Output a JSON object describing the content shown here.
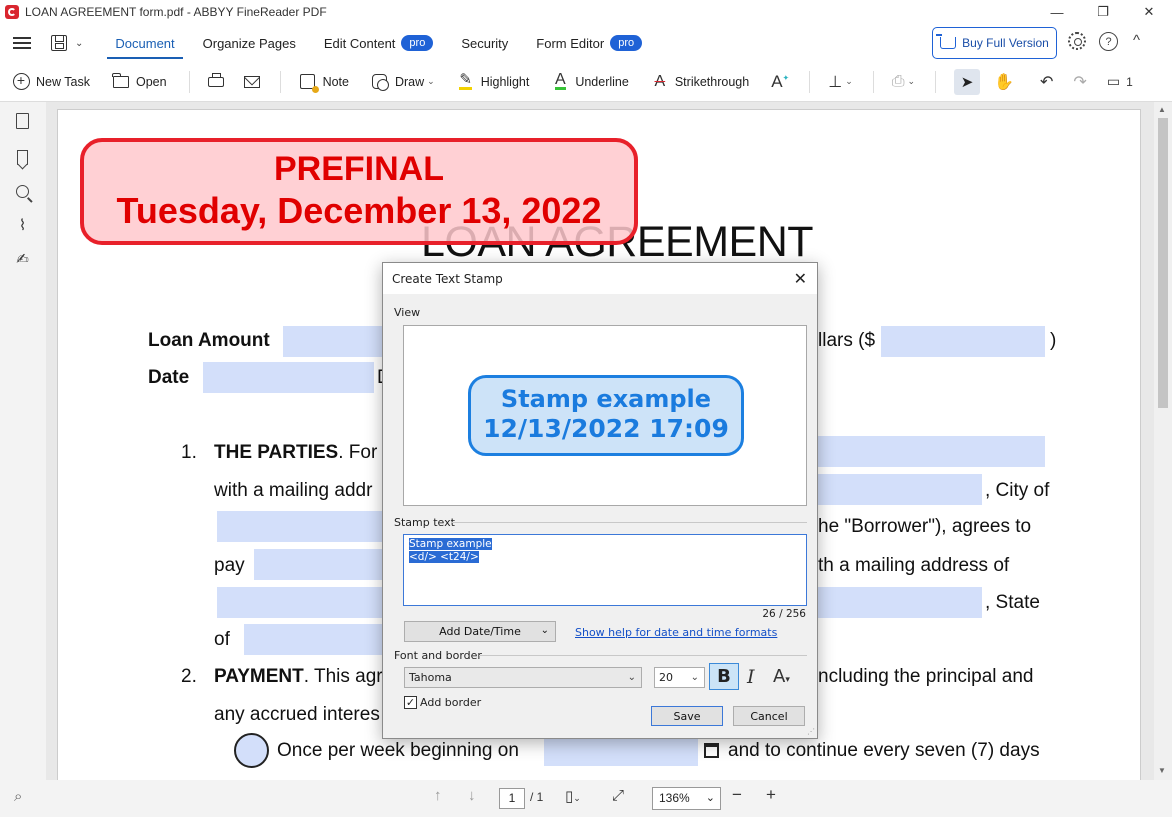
{
  "window": {
    "title": "LOAN AGREEMENT form.pdf - ABBYY FineReader PDF",
    "minimize": "—",
    "restore": "❐",
    "close": "✕"
  },
  "menu": {
    "tabs": [
      {
        "label": "Document",
        "active": true
      },
      {
        "label": "Organize Pages"
      },
      {
        "label": "Edit Content",
        "badge": "pro"
      },
      {
        "label": "Security"
      },
      {
        "label": "Form Editor",
        "badge": "pro"
      }
    ],
    "buy_label": "Buy Full Version",
    "help_glyph": "?",
    "collapse_glyph": "^"
  },
  "toolbar": {
    "new_task": "New Task",
    "open": "Open",
    "note": "Note",
    "draw": "Draw",
    "highlight": "Highlight",
    "underline": "Underline",
    "strikethrough": "Strikethrough",
    "comments_count": "1"
  },
  "document": {
    "stamp_line1": "PREFINAL",
    "stamp_line2": "Tuesday, December 13, 2022",
    "title": "LOAN AGREEMENT",
    "loan_amount_label": "Loan Amount",
    "dollars_text": "llars ($",
    "close_paren": ")",
    "date_label": "Date",
    "date_partial": "D",
    "item1_number": "1.",
    "item1_heading": "THE PARTIES",
    "item1_text": ". For th",
    "mailing_text": "with a mailing addr",
    "city_text": ", City of",
    "borrower_text": "he \"Borrower\"), agrees to",
    "pay_text": "pay",
    "mailing2_text": "th a mailing address of",
    "state_text": ", State",
    "of_text": "of",
    "item2_number": "2.",
    "item2_heading": "PAYMENT",
    "item2_text": ". This agr",
    "including_text": "ncluding the principal and",
    "accrued_text": "any accrued interes",
    "weekly_text": "Once per week beginning on",
    "continue_text": "and to continue every seven (7) days"
  },
  "statusbar": {
    "current_page": "1",
    "total_pages": "/ 1",
    "zoom": "136%"
  },
  "dialog": {
    "title": "Create Text Stamp",
    "view_label": "View",
    "preview_line1": "Stamp example",
    "preview_line2": "12/13/2022 17:09",
    "stamp_text_label": "Stamp text",
    "stamp_text_line1": "Stamp example",
    "stamp_text_line2": "<d/> <t24/>",
    "char_count": "26 / 256",
    "add_datetime": "Add Date/Time",
    "help_link": "Show help for date and time formats",
    "font_border_label": "Font and border",
    "font_name": "Tahoma",
    "font_size": "20",
    "bold_glyph": "B",
    "italic_glyph": "I",
    "color_glyph": "A",
    "add_border_label": "Add border",
    "add_border_checked": "✓",
    "save": "Save",
    "cancel": "Cancel"
  },
  "colors": {
    "accent": "#1f62d6",
    "stamp_red": "#e8202a",
    "stamp_blue": "#1c7fe0",
    "field_fill": "#d3dffa"
  }
}
